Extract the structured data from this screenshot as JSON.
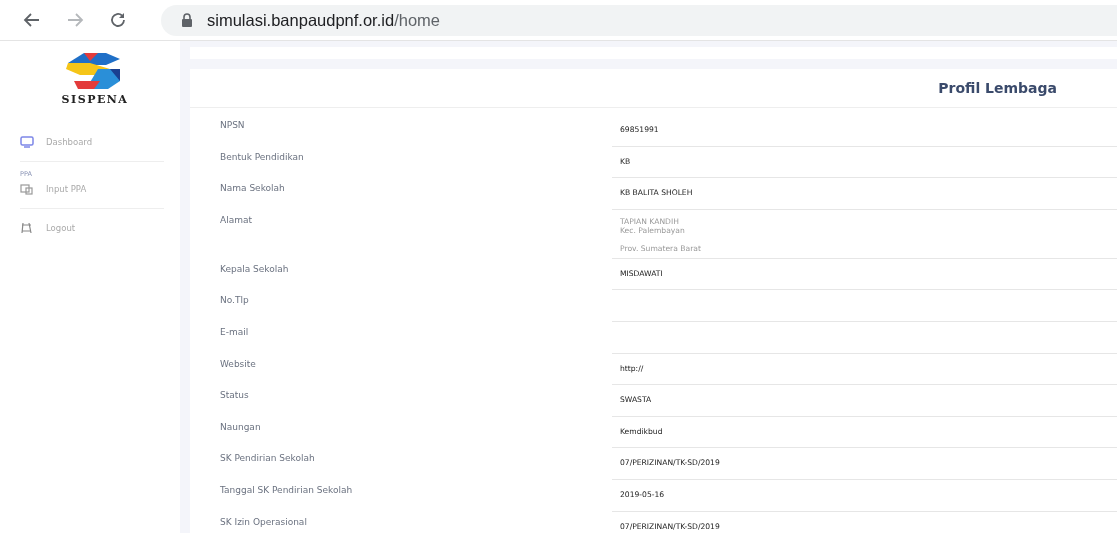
{
  "browser": {
    "url_host": "simulasi.banpaudpnf.or.id",
    "url_path": "/home"
  },
  "sidebar": {
    "logo_text": "SISPENA",
    "items": [
      {
        "kind": "link",
        "label": "Dashboard"
      },
      {
        "kind": "divider"
      },
      {
        "kind": "heading",
        "label": "PPA"
      },
      {
        "kind": "link",
        "label": "Input PPA"
      },
      {
        "kind": "divider"
      },
      {
        "kind": "link",
        "label": "Logout"
      }
    ]
  },
  "card": {
    "title": "Profil Lembaga",
    "rows": [
      {
        "label": "NPSN",
        "value": [
          "69851991"
        ]
      },
      {
        "label": "Bentuk Pendidikan",
        "value": [
          "KB"
        ]
      },
      {
        "label": "Nama Sekolah",
        "value": [
          "KB BALITA SHOLEH"
        ]
      },
      {
        "label": "Alamat",
        "kind": "address",
        "value": [
          "TAPIAN KANDIH",
          "Kec. Palembayan",
          "Prov. Sumatera Barat"
        ]
      },
      {
        "label": "Kepala Sekolah",
        "value": [
          "MISDAWATI"
        ]
      },
      {
        "label": "No.Tlp",
        "value": []
      },
      {
        "label": "E-mail",
        "value": []
      },
      {
        "label": "Website",
        "value": [
          "http://"
        ]
      },
      {
        "label": "Status",
        "value": [
          "SWASTA"
        ]
      },
      {
        "label": "Naungan",
        "value": [
          "Kemdikbud"
        ]
      },
      {
        "label": "SK Pendirian Sekolah",
        "value": [
          "07/PERIZINAN/TK-SD/2019"
        ]
      },
      {
        "label": "Tanggal SK Pendirian Sekolah",
        "value": [
          "2019-05-16"
        ]
      },
      {
        "label": "SK Izin Operasional",
        "value": [
          "07/PERIZINAN/TK-SD/2019"
        ]
      }
    ]
  }
}
